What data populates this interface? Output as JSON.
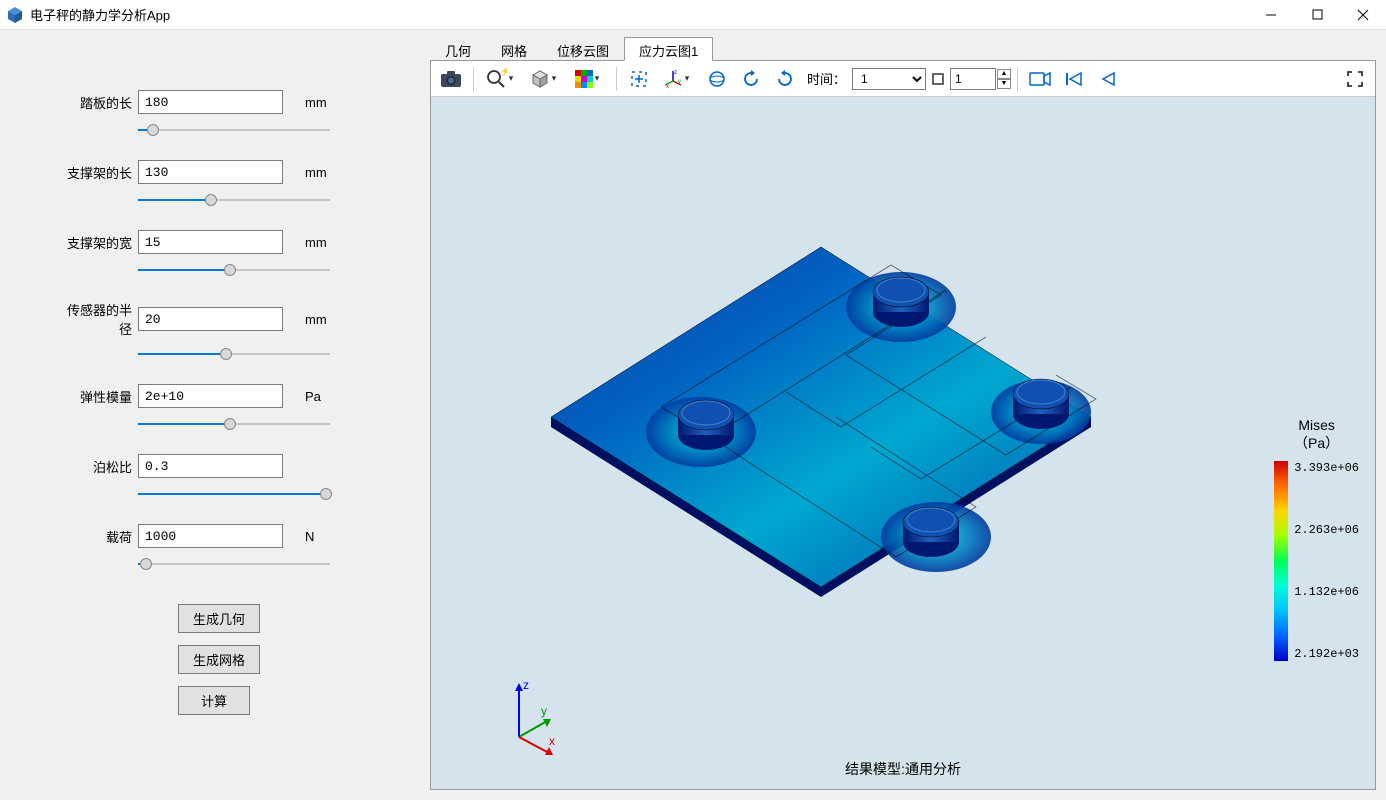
{
  "window": {
    "title": "电子秤的静力学分析App"
  },
  "params": [
    {
      "label": "踏板的长",
      "value": "180",
      "unit": "mm",
      "slider_pct": 8
    },
    {
      "label": "支撑架的长",
      "value": "130",
      "unit": "mm",
      "slider_pct": 38
    },
    {
      "label": "支撑架的宽",
      "value": "15",
      "unit": "mm",
      "slider_pct": 48
    },
    {
      "label": "传感器的半径",
      "value": "20",
      "unit": "mm",
      "slider_pct": 46
    },
    {
      "label": "弹性模量",
      "value": "2e+10",
      "unit": "Pa",
      "slider_pct": 48
    },
    {
      "label": "泊松比",
      "value": "0.3",
      "unit": "",
      "slider_pct": 98
    },
    {
      "label": "载荷",
      "value": "1000",
      "unit": "N",
      "slider_pct": 4
    }
  ],
  "buttons": {
    "generate_geometry": "生成几何",
    "generate_mesh": "生成网格",
    "compute": "计算"
  },
  "tabs": [
    "几何",
    "网格",
    "位移云图",
    "应力云图1"
  ],
  "active_tab": 3,
  "toolbar": {
    "time_label": "时间：",
    "time_select": "1",
    "frame_field": "1"
  },
  "viewport": {
    "result_label": "结果模型:通用分析",
    "axes": {
      "x": "x",
      "y": "y",
      "z": "z"
    }
  },
  "legend": {
    "title_line1": "Mises",
    "title_line2": "（Pa）",
    "ticks": [
      "3.393e+06",
      "2.263e+06",
      "1.132e+06",
      "2.192e+03"
    ]
  }
}
